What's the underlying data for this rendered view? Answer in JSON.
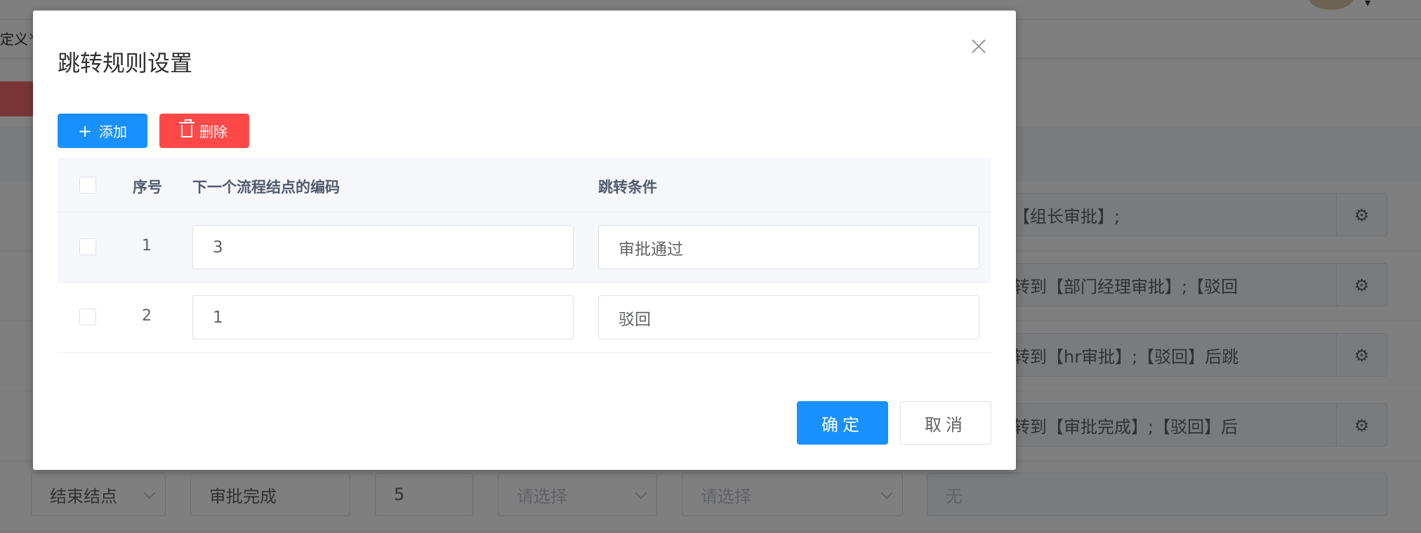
{
  "background": {
    "tab_label": "定义",
    "tab_close": "×",
    "row_texts": [
      "后跳转到【组长审批】;",
      "过】后跳转到【部门经理审批】;【驳回",
      "过】后跳转到【hr审批】;【驳回】后跳",
      "过】后跳转到【审批完成】;【驳回】后"
    ],
    "last_row": {
      "type": "结束结点",
      "name": "审批完成",
      "code": "5",
      "select1_placeholder": "请选择",
      "select2_placeholder": "请选择",
      "rule": "无"
    }
  },
  "dialog": {
    "title": "跳转规则设置",
    "add_label": "添加",
    "delete_label": "删除",
    "table": {
      "headers": {
        "index": "序号",
        "next_code": "下一个流程结点的编码",
        "condition": "跳转条件"
      },
      "rows": [
        {
          "index": "1",
          "next_code": "3",
          "condition": "审批通过"
        },
        {
          "index": "2",
          "next_code": "1",
          "condition": "驳回"
        }
      ]
    },
    "confirm_label": "确定",
    "cancel_label": "取消"
  },
  "colors": {
    "primary": "#1890ff",
    "danger": "#ff4949",
    "overlay": "rgba(0,0,0,0.5)"
  }
}
